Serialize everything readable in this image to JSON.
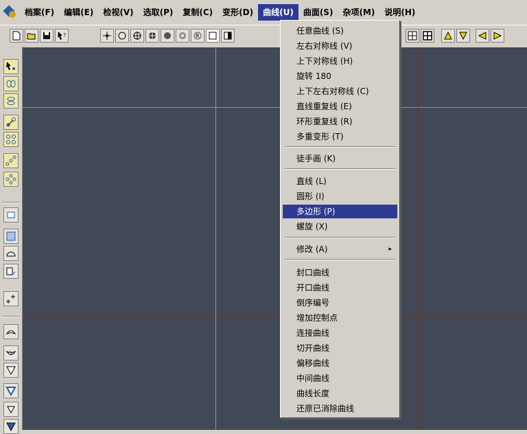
{
  "menubar": {
    "items": [
      {
        "label": "档案(F)"
      },
      {
        "label": "编辑(E)"
      },
      {
        "label": "检视(V)"
      },
      {
        "label": "选取(P)"
      },
      {
        "label": "复制(C)"
      },
      {
        "label": "变形(D)"
      },
      {
        "label": "曲线(U)",
        "active": true
      },
      {
        "label": "曲面(S)"
      },
      {
        "label": "杂项(M)"
      },
      {
        "label": "说明(H)"
      }
    ]
  },
  "toolbar": {
    "icons": [
      "new-file-icon",
      "open-folder-icon",
      "save-icon",
      "help-pointer-icon",
      "snap-point-icon",
      "circle-icon",
      "grid-crosshair-icon",
      "solid-circle-crosshair-icon",
      "solid-circle-icon",
      "ring-circle-icon",
      "ring-r-icon",
      "square-icon",
      "square-half-icon",
      "grid-2x2-icon",
      "grid-3x3-icon",
      "triangle-up-icon",
      "triangle-down-icon",
      "triangle-left-icon",
      "triangle-right-icon"
    ]
  },
  "curve_menu": {
    "items": [
      {
        "label": "任意曲线 (S)"
      },
      {
        "label": "左右对称线 (V)"
      },
      {
        "label": "上下对称线 (H)"
      },
      {
        "label": "旋转 180"
      },
      {
        "label": "上下左右对称线 (C)"
      },
      {
        "label": "直线重复线 (E)"
      },
      {
        "label": "环形重复线 (R)"
      },
      {
        "label": "多重变形 (T)"
      },
      {
        "label": "徒手画 (K)"
      },
      {
        "label": "直线 (L)"
      },
      {
        "label": "圆形 (I)"
      },
      {
        "label": "多边形 (P)",
        "highlighted": true
      },
      {
        "label": "螺旋 (X)"
      },
      {
        "label": "修改 (A)",
        "submenu_arrow": "▸"
      },
      {
        "label": "封口曲线"
      },
      {
        "label": "开口曲线"
      },
      {
        "label": "倒序编号"
      },
      {
        "label": "增加控制点"
      },
      {
        "label": "连接曲线"
      },
      {
        "label": "切开曲线"
      },
      {
        "label": "偏移曲线"
      },
      {
        "label": "中间曲线"
      },
      {
        "label": "曲线长度"
      },
      {
        "label": "还原已消除曲线"
      }
    ]
  },
  "colors": {
    "canvas": "#404955",
    "grid_light": "#8e96a2",
    "grid_dark": "#7a2a2a",
    "menu_highlight": "#2e3b94",
    "menu_bg": "#d4d0c8"
  }
}
